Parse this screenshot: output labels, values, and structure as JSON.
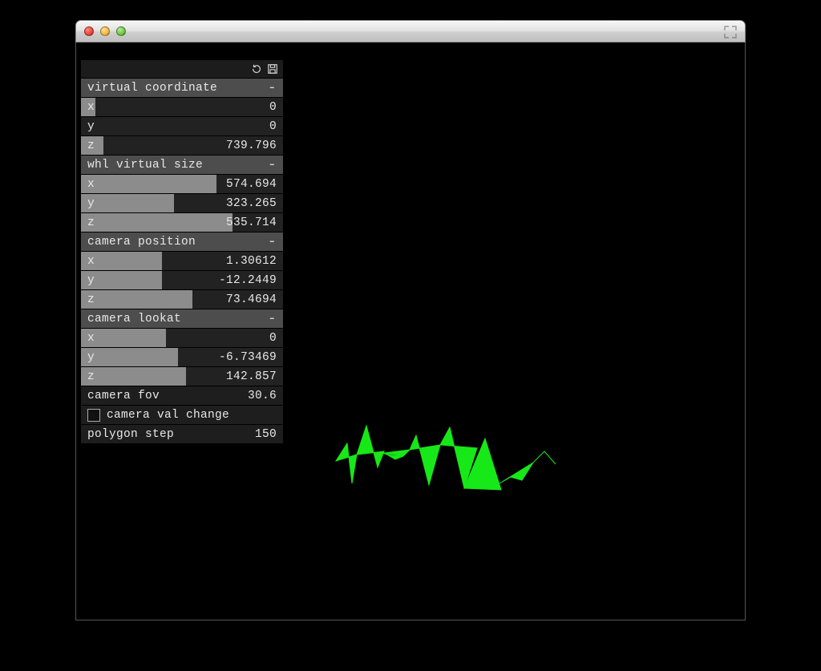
{
  "panel": {
    "groups": [
      {
        "title": "virtual coordinate",
        "rows": [
          {
            "label": "x",
            "value": "0",
            "fill": 0.07
          },
          {
            "label": "y",
            "value": "0",
            "fill": 0.0
          },
          {
            "label": "z",
            "value": "739.796",
            "fill": 0.11
          }
        ]
      },
      {
        "title": "whl virtual size",
        "rows": [
          {
            "label": "x",
            "value": "574.694",
            "fill": 0.67
          },
          {
            "label": "y",
            "value": "323.265",
            "fill": 0.46
          },
          {
            "label": "z",
            "value": "535.714",
            "fill": 0.75
          }
        ]
      },
      {
        "title": "camera position",
        "rows": [
          {
            "label": "x",
            "value": "1.30612",
            "fill": 0.4
          },
          {
            "label": "y",
            "value": "-12.2449",
            "fill": 0.4
          },
          {
            "label": "z",
            "value": "73.4694",
            "fill": 0.55
          }
        ]
      },
      {
        "title": "camera lookat",
        "rows": [
          {
            "label": "x",
            "value": "0",
            "fill": 0.42
          },
          {
            "label": "y",
            "value": "-6.73469",
            "fill": 0.48
          },
          {
            "label": "z",
            "value": "142.857",
            "fill": 0.52
          }
        ]
      }
    ],
    "extras": {
      "fov_label": "camera fov",
      "fov_value": "30.6",
      "check_label": "camera val change",
      "check_checked": false,
      "step_label": "polygon step",
      "step_value": "150"
    }
  }
}
